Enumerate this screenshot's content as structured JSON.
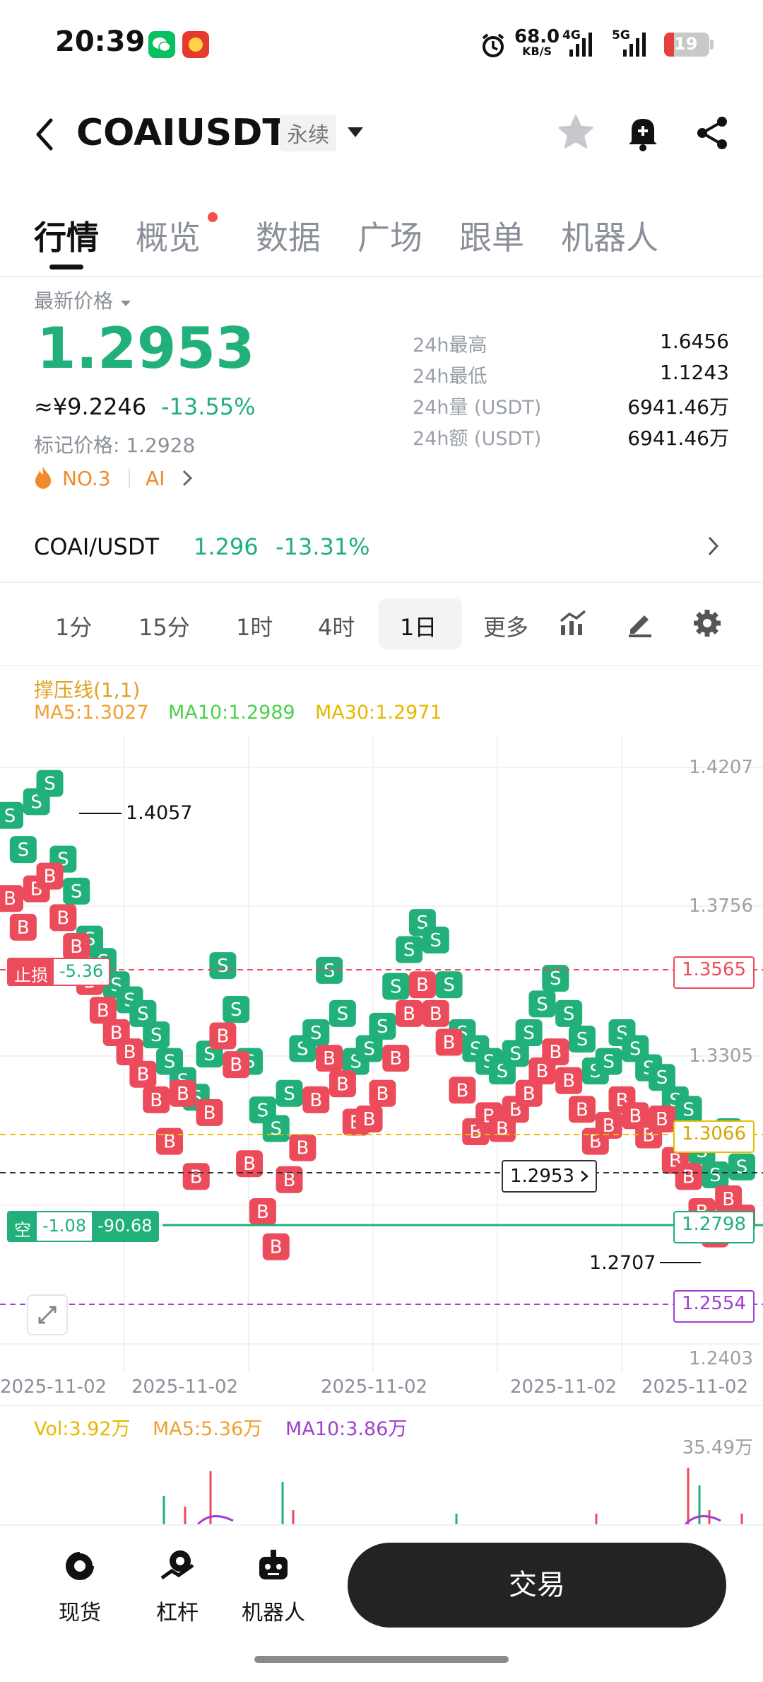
{
  "status_bar": {
    "time": "20:39",
    "net_speed": "68.0",
    "net_unit": "KB/S",
    "net_4g": "4G",
    "net_5g": "5G",
    "battery": "19"
  },
  "header": {
    "symbol": "COAIUSDT",
    "contract_type": "永续"
  },
  "tabs": [
    {
      "label": "行情",
      "active": true
    },
    {
      "label": "概览",
      "active": false
    },
    {
      "label": "数据",
      "active": false
    },
    {
      "label": "广场",
      "active": false
    },
    {
      "label": "跟单",
      "active": false
    },
    {
      "label": "机器人",
      "active": false
    }
  ],
  "price_panel": {
    "latest_label": "最新价格",
    "price": "1.2953",
    "cny": "≈¥9.2246",
    "change": "-13.55%",
    "mark_label": "标记价格: 1.2928",
    "rank": "NO.3",
    "tag": "AI",
    "stats": [
      {
        "label": "24h最高",
        "value": "1.6456"
      },
      {
        "label": "24h最低",
        "value": "1.1243"
      },
      {
        "label": "24h量 (USDT)",
        "value": "6941.46万"
      },
      {
        "label": "24h额 (USDT)",
        "value": "6941.46万"
      }
    ]
  },
  "spot_row": {
    "pair": "COAI/USDT",
    "price": "1.296",
    "change": "-13.31%"
  },
  "intervals": [
    "1分",
    "15分",
    "1时",
    "4时",
    "1日",
    "更多"
  ],
  "active_interval": "1日",
  "chart": {
    "indicator_title": "撑压线(1,1)",
    "ma5": "MA5:1.3027",
    "ma10": "MA10:1.2989",
    "ma30": "MA30:1.2971",
    "y_ticks": [
      "1.4207",
      "1.3756",
      "1.3305",
      "1.2403"
    ],
    "x_ticks": [
      "2025-11-02",
      "2025-11-02",
      "2025-11-02",
      "2025-11-02",
      "2025-11-02"
    ],
    "high_marker": "1.4057",
    "low_marker": "1.2707",
    "stop_loss_label": "止损",
    "stop_loss_value": "-5.36",
    "stop_loss_price": "1.3565",
    "ma_line_price": "1.3066",
    "current_price": "1.2953",
    "position_side": "空",
    "position_pnl": "-1.08",
    "position_pnl2": "-90.68",
    "position_price": "1.2798",
    "purple_price": "1.2554",
    "colors": {
      "up": "#21b07a",
      "down": "#ec4b5b",
      "ma5": "#f0a030",
      "ma10": "#4bd14b",
      "ma30": "#e6b800",
      "purple": "#a040d0"
    },
    "trade_marks": [
      {
        "t": 0,
        "p": 1.4057,
        "s": "S"
      },
      {
        "t": 1,
        "p": 1.395,
        "s": "S"
      },
      {
        "t": 2,
        "p": 1.41,
        "s": "S"
      },
      {
        "t": 3,
        "p": 1.4157,
        "s": "S"
      },
      {
        "t": 4,
        "p": 1.392,
        "s": "S"
      },
      {
        "t": 5,
        "p": 1.382,
        "s": "S"
      },
      {
        "t": 6,
        "p": 1.367,
        "s": "S"
      },
      {
        "t": 7,
        "p": 1.36,
        "s": "S"
      },
      {
        "t": 8,
        "p": 1.3527,
        "s": "S"
      },
      {
        "t": 9,
        "p": 1.348,
        "s": "S"
      },
      {
        "t": 10,
        "p": 1.3437,
        "s": "S"
      },
      {
        "t": 11,
        "p": 1.337,
        "s": "S"
      },
      {
        "t": 12,
        "p": 1.3287,
        "s": "S"
      },
      {
        "t": 13,
        "p": 1.3227,
        "s": "S"
      },
      {
        "t": 14,
        "p": 1.3175,
        "s": "S"
      },
      {
        "t": 15,
        "p": 1.331,
        "s": "S"
      },
      {
        "t": 16,
        "p": 1.3587,
        "s": "S"
      },
      {
        "t": 17,
        "p": 1.345,
        "s": "S"
      },
      {
        "t": 18,
        "p": 1.3287,
        "s": "S"
      },
      {
        "t": 19,
        "p": 1.3135,
        "s": "S"
      },
      {
        "t": 20,
        "p": 1.3077,
        "s": "S"
      },
      {
        "t": 21,
        "p": 1.3187,
        "s": "S"
      },
      {
        "t": 22,
        "p": 1.3327,
        "s": "S"
      },
      {
        "t": 23,
        "p": 1.3377,
        "s": "S"
      },
      {
        "t": 24,
        "p": 1.3572,
        "s": "S"
      },
      {
        "t": 25,
        "p": 1.3437,
        "s": "S"
      },
      {
        "t": 26,
        "p": 1.3287,
        "s": "S"
      },
      {
        "t": 27,
        "p": 1.3327,
        "s": "S"
      },
      {
        "t": 28,
        "p": 1.3397,
        "s": "S"
      },
      {
        "t": 29,
        "p": 1.3522,
        "s": "S"
      },
      {
        "t": 30,
        "p": 1.3637,
        "s": "S"
      },
      {
        "t": 31,
        "p": 1.3722,
        "s": "S"
      },
      {
        "t": 32,
        "p": 1.3667,
        "s": "S"
      },
      {
        "t": 33,
        "p": 1.3527,
        "s": "S"
      },
      {
        "t": 34,
        "p": 1.3377,
        "s": "S"
      },
      {
        "t": 35,
        "p": 1.3327,
        "s": "S"
      },
      {
        "t": 36,
        "p": 1.3287,
        "s": "S"
      },
      {
        "t": 37,
        "p": 1.3257,
        "s": "S"
      },
      {
        "t": 38,
        "p": 1.3312,
        "s": "S"
      },
      {
        "t": 39,
        "p": 1.3377,
        "s": "S"
      },
      {
        "t": 40,
        "p": 1.3467,
        "s": "S"
      },
      {
        "t": 41,
        "p": 1.3547,
        "s": "S"
      },
      {
        "t": 42,
        "p": 1.3437,
        "s": "S"
      },
      {
        "t": 43,
        "p": 1.3357,
        "s": "S"
      },
      {
        "t": 44,
        "p": 1.3257,
        "s": "S"
      },
      {
        "t": 45,
        "p": 1.3287,
        "s": "S"
      },
      {
        "t": 46,
        "p": 1.3377,
        "s": "S"
      },
      {
        "t": 47,
        "p": 1.3327,
        "s": "S"
      },
      {
        "t": 48,
        "p": 1.3267,
        "s": "S"
      },
      {
        "t": 49,
        "p": 1.3237,
        "s": "S"
      },
      {
        "t": 50,
        "p": 1.3167,
        "s": "S"
      },
      {
        "t": 51,
        "p": 1.3137,
        "s": "S"
      },
      {
        "t": 52,
        "p": 1.3007,
        "s": "S"
      },
      {
        "t": 53,
        "p": 1.2932,
        "s": "S"
      },
      {
        "t": 54,
        "p": 1.3067,
        "s": "S"
      },
      {
        "t": 55,
        "p": 1.2957,
        "s": "S"
      },
      {
        "t": 0,
        "p": 1.3797,
        "s": "B"
      },
      {
        "t": 1,
        "p": 1.3707,
        "s": "B"
      },
      {
        "t": 2,
        "p": 1.3827,
        "s": "B"
      },
      {
        "t": 3,
        "p": 1.3867,
        "s": "B"
      },
      {
        "t": 4,
        "p": 1.3737,
        "s": "B"
      },
      {
        "t": 5,
        "p": 1.3647,
        "s": "B"
      },
      {
        "t": 6,
        "p": 1.3537,
        "s": "B"
      },
      {
        "t": 7,
        "p": 1.3447,
        "s": "B"
      },
      {
        "t": 8,
        "p": 1.3377,
        "s": "B"
      },
      {
        "t": 9,
        "p": 1.3317,
        "s": "B"
      },
      {
        "t": 10,
        "p": 1.3247,
        "s": "B"
      },
      {
        "t": 11,
        "p": 1.3167,
        "s": "B"
      },
      {
        "t": 12,
        "p": 1.3037,
        "s": "B"
      },
      {
        "t": 13,
        "p": 1.3187,
        "s": "B"
      },
      {
        "t": 14,
        "p": 1.2927,
        "s": "B"
      },
      {
        "t": 15,
        "p": 1.3127,
        "s": "B"
      },
      {
        "t": 16,
        "p": 1.3367,
        "s": "B"
      },
      {
        "t": 17,
        "p": 1.3277,
        "s": "B"
      },
      {
        "t": 18,
        "p": 1.2967,
        "s": "B"
      },
      {
        "t": 19,
        "p": 1.2817,
        "s": "B"
      },
      {
        "t": 20,
        "p": 1.2707,
        "s": "B"
      },
      {
        "t": 21,
        "p": 1.2917,
        "s": "B"
      },
      {
        "t": 22,
        "p": 1.3017,
        "s": "B"
      },
      {
        "t": 23,
        "p": 1.3167,
        "s": "B"
      },
      {
        "t": 24,
        "p": 1.3297,
        "s": "B"
      },
      {
        "t": 25,
        "p": 1.3217,
        "s": "B"
      },
      {
        "t": 26,
        "p": 1.3097,
        "s": "B"
      },
      {
        "t": 27,
        "p": 1.3107,
        "s": "B"
      },
      {
        "t": 28,
        "p": 1.3187,
        "s": "B"
      },
      {
        "t": 29,
        "p": 1.3297,
        "s": "B"
      },
      {
        "t": 30,
        "p": 1.3437,
        "s": "B"
      },
      {
        "t": 31,
        "p": 1.3527,
        "s": "B"
      },
      {
        "t": 32,
        "p": 1.3437,
        "s": "B"
      },
      {
        "t": 33,
        "p": 1.3347,
        "s": "B"
      },
      {
        "t": 34,
        "p": 1.3197,
        "s": "B"
      },
      {
        "t": 35,
        "p": 1.3067,
        "s": "B"
      },
      {
        "t": 36,
        "p": 1.3117,
        "s": "B"
      },
      {
        "t": 37,
        "p": 1.3077,
        "s": "B"
      },
      {
        "t": 38,
        "p": 1.3137,
        "s": "B"
      },
      {
        "t": 39,
        "p": 1.3187,
        "s": "B"
      },
      {
        "t": 40,
        "p": 1.3257,
        "s": "B"
      },
      {
        "t": 41,
        "p": 1.3317,
        "s": "B"
      },
      {
        "t": 42,
        "p": 1.3227,
        "s": "B"
      },
      {
        "t": 43,
        "p": 1.3137,
        "s": "B"
      },
      {
        "t": 44,
        "p": 1.3037,
        "s": "B"
      },
      {
        "t": 45,
        "p": 1.3087,
        "s": "B"
      },
      {
        "t": 46,
        "p": 1.3167,
        "s": "B"
      },
      {
        "t": 47,
        "p": 1.3117,
        "s": "B"
      },
      {
        "t": 48,
        "p": 1.3057,
        "s": "B"
      },
      {
        "t": 49,
        "p": 1.3107,
        "s": "B"
      },
      {
        "t": 50,
        "p": 1.2977,
        "s": "B"
      },
      {
        "t": 51,
        "p": 1.2927,
        "s": "B"
      },
      {
        "t": 52,
        "p": 1.2817,
        "s": "B"
      },
      {
        "t": 53,
        "p": 1.2747,
        "s": "B"
      },
      {
        "t": 54,
        "p": 1.2857,
        "s": "B"
      },
      {
        "t": 55,
        "p": 1.2797,
        "s": "B"
      }
    ]
  },
  "volume": {
    "vol": "Vol:3.92万",
    "ma5": "MA5:5.36万",
    "ma10": "MA10:3.86万",
    "max_tick": "35.49万"
  },
  "bottom_nav": [
    {
      "label": "现货"
    },
    {
      "label": "杠杆"
    },
    {
      "label": "机器人"
    }
  ],
  "trade_button": "交易"
}
